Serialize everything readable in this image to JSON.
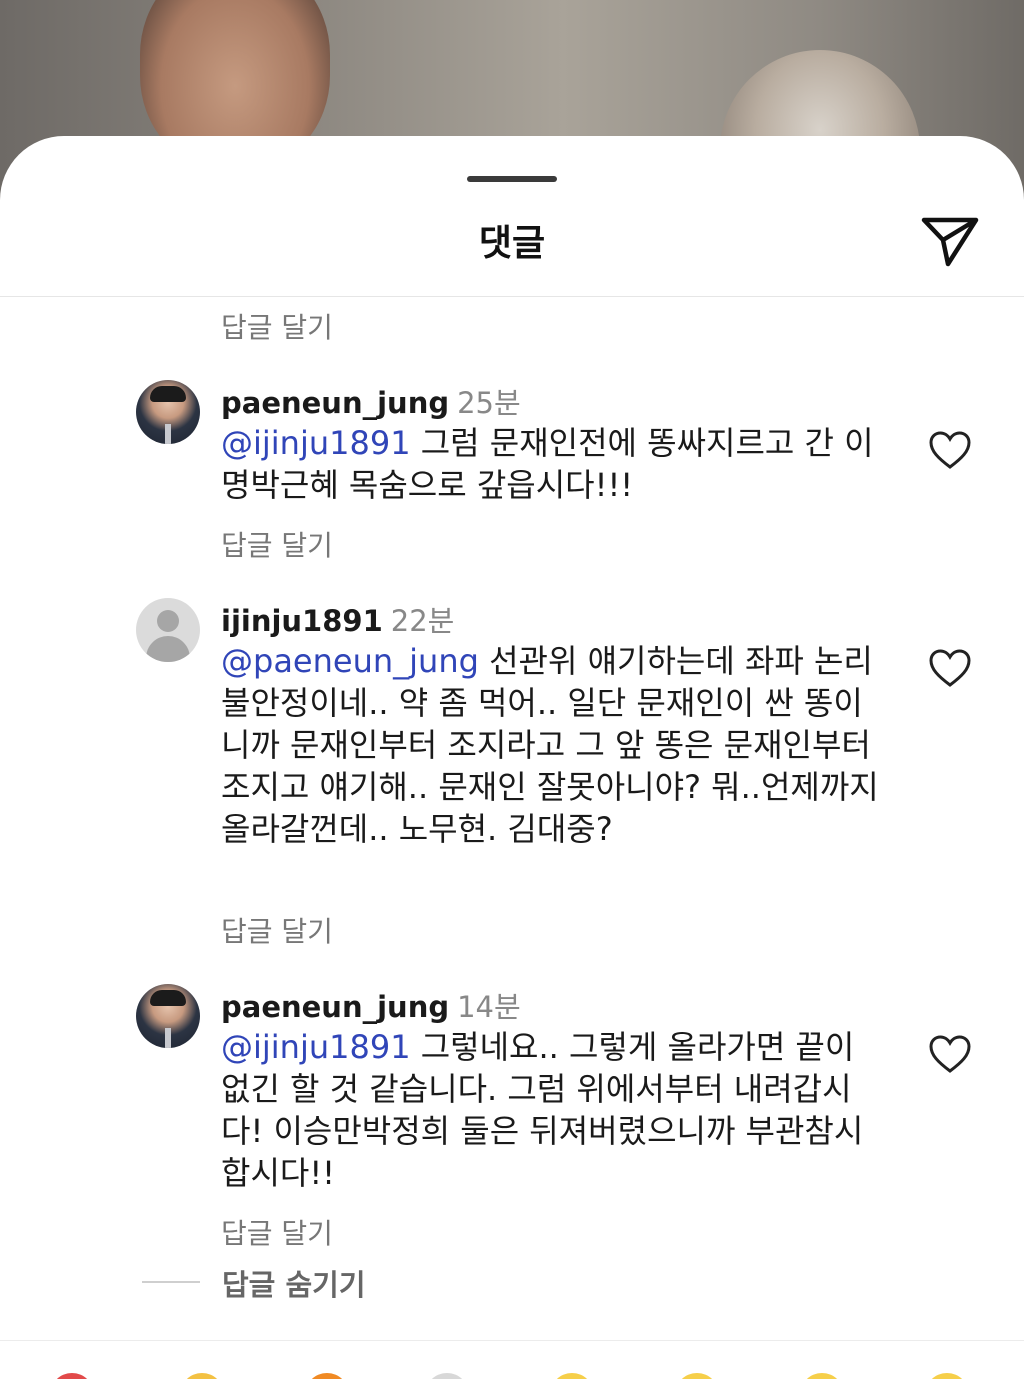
{
  "sheet": {
    "title": "댓글",
    "share_icon": "paper-plane-icon"
  },
  "reply_label": "답글 달기",
  "comments": [
    {
      "username": "paeneun_jung",
      "time": "25분",
      "mention": "@ijinju1891",
      "text": " 그럼 문재인전에 똥싸지르고 간 이명박근혜 목숨으로 갚읍시다!!!",
      "avatar": "photo"
    },
    {
      "username": "ijinju1891",
      "time": "22분",
      "mention": "@paeneun_jung",
      "text": " 선관위 얘기하는데 좌파 논리 불안정이네.. 약 좀 먹어.. 일단 문재인이 싼 똥이니까 문재인부터 조지라고 그 앞 똥은 문재인부터 조지고 얘기해.. 문재인 잘못아니야? 뭐..언제까지 올라갈껀데.. 노무현. 김대중?",
      "avatar": "default"
    },
    {
      "username": "paeneun_jung",
      "time": "14분",
      "mention": "@ijinju1891",
      "text": " 그렇네요.. 그렇게 올라가면 끝이 없긴 할 것 같습니다. 그럼 위에서부터 내려갑시다! 이승만박정희 둘은 뒤져버렸으니까 부관참시합시다!!",
      "avatar": "photo"
    }
  ],
  "hide_replies_label": "답글 숨기기",
  "colors": {
    "mention": "#3045b8",
    "muted": "#777777",
    "text": "#1a1a1a"
  }
}
